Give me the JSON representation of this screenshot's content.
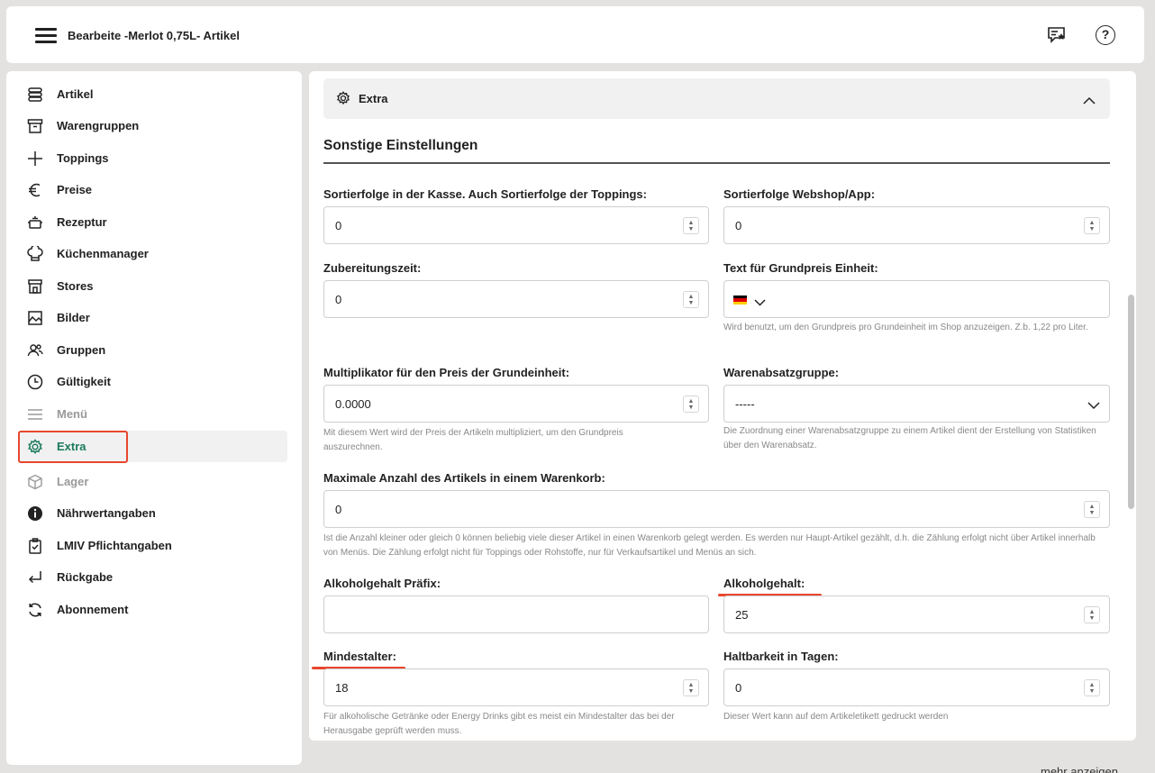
{
  "header": {
    "title": "Bearbeite -Merlot 0,75L- Artikel"
  },
  "sidebar": {
    "items": [
      {
        "label": "Artikel",
        "icon": "stack-icon"
      },
      {
        "label": "Warengruppen",
        "icon": "box-icon"
      },
      {
        "label": "Toppings",
        "icon": "plus-icon"
      },
      {
        "label": "Preise",
        "icon": "euro-icon"
      },
      {
        "label": "Rezeptur",
        "icon": "pot-icon"
      },
      {
        "label": "Küchenmanager",
        "icon": "chef-hat-icon"
      },
      {
        "label": "Stores",
        "icon": "store-icon"
      },
      {
        "label": "Bilder",
        "icon": "image-icon"
      },
      {
        "label": "Gruppen",
        "icon": "users-icon"
      },
      {
        "label": "Gültigkeit",
        "icon": "clock-icon"
      },
      {
        "label": "Menü",
        "icon": "menu-icon"
      },
      {
        "label": "Extra",
        "icon": "gear-icon"
      },
      {
        "label": "Lager",
        "icon": "cube-icon"
      },
      {
        "label": "Nährwertangaben",
        "icon": "info-icon"
      },
      {
        "label": "LMIV Pflichtangaben",
        "icon": "clipboard-icon"
      },
      {
        "label": "Rückgabe",
        "icon": "return-arrow-icon"
      },
      {
        "label": "Abonnement",
        "icon": "refresh-icon"
      }
    ]
  },
  "section": {
    "title": "Extra",
    "subheading": "Sonstige Einstellungen"
  },
  "fields": {
    "sort_pos": {
      "label": "Sortierfolge in der Kasse. Auch Sortierfolge der Toppings:",
      "value": "0"
    },
    "sort_shop": {
      "label": "Sortierfolge Webshop/App:",
      "value": "0"
    },
    "prep_time": {
      "label": "Zubereitungszeit:",
      "value": "0"
    },
    "base_unit_text": {
      "label": "Text für Grundpreis Einheit:",
      "help": "Wird benutzt, um den Grundpreis pro Grundeinheit im Shop anzuzeigen. Z.b. 1,22 pro Liter."
    },
    "multiplier": {
      "label": "Multiplikator für den Preis der Grundeinheit:",
      "value": "0.0000",
      "help": "Mit diesem Wert wird der Preis der Artikeln multipliziert, um den Grundpreis auszurechnen."
    },
    "sales_group": {
      "label": "Warenabsatzgruppe:",
      "value": "-----",
      "help": "Die Zuordnung einer Warenabsatzgruppe zu einem Artikel dient der Erstellung von Statistiken über den Warenabsatz."
    },
    "max_cart": {
      "label": "Maximale Anzahl des Artikels in einem Warenkorb:",
      "value": "0",
      "help": "Ist die Anzahl kleiner oder gleich 0 können beliebig viele dieser Artikel in einen Warenkorb gelegt werden. Es werden nur Haupt-Artikel gezählt, d.h. die Zählung erfolgt nicht über Artikel innerhalb von Menüs. Die Zählung erfolgt nicht für Toppings oder Rohstoffe, nur für Verkaufsartikel und Menüs an sich."
    },
    "alcohol_prefix": {
      "label": "Alkoholgehalt Präfix:",
      "value": ""
    },
    "alcohol": {
      "label": "Alkoholgehalt:",
      "value": "25"
    },
    "min_age": {
      "label": "Mindestalter:",
      "value": "18",
      "help": "Für alkoholische Getränke oder Energy Drinks gibt es meist ein Mindestalter das bei der Herausgabe geprüft werden muss."
    },
    "shelf_life": {
      "label": "Haltbarkeit in Tagen:",
      "value": "0",
      "help": "Dieser Wert kann auf dem Artikeletikett gedruckt werden"
    }
  },
  "footer": {
    "more_label": "mehr anzeigen"
  },
  "colors": {
    "accent": "#1c7a5e",
    "highlight": "#e8472d"
  }
}
